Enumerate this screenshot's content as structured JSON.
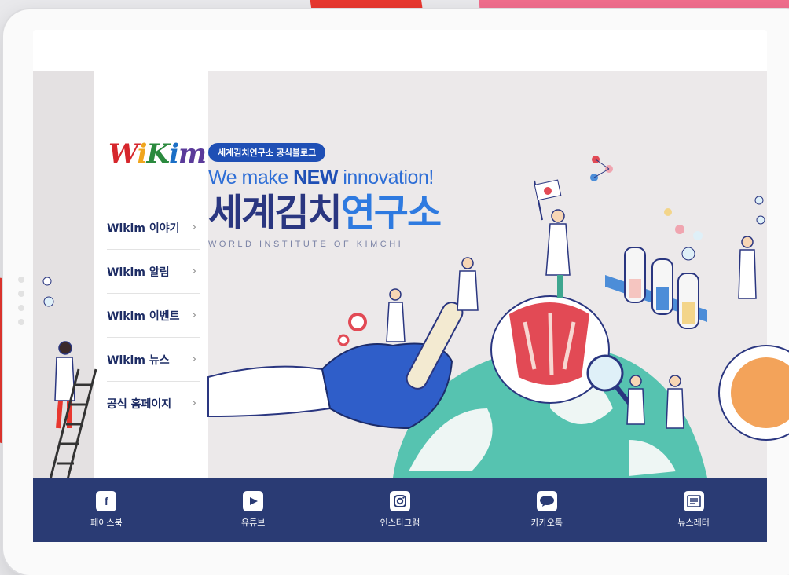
{
  "blog": {
    "logo_text": "WiKim",
    "tag": "세계김치연구소 공식블로그",
    "tagline_prefix": "We make",
    "tagline_emph": "NEW",
    "tagline_suffix": "innovation!",
    "title_part1": "세계김치",
    "title_part2": "연구소",
    "subtitle": "WORLD INSTITUTE OF KIMCHI"
  },
  "sidebar": {
    "items": [
      {
        "label": "Wikim 이야기",
        "arrow": "›"
      },
      {
        "label": "Wikim 알림",
        "arrow": "›"
      },
      {
        "label": "Wikim 이벤트",
        "arrow": "›"
      },
      {
        "label": "Wikim 뉴스",
        "arrow": "›"
      },
      {
        "label": "공식 홈페이지",
        "arrow": "›"
      }
    ]
  },
  "footer": {
    "items": [
      {
        "label": "페이스북",
        "icon": "facebook-icon"
      },
      {
        "label": "유튜브",
        "icon": "youtube-icon"
      },
      {
        "label": "인스타그램",
        "icon": "instagram-icon"
      },
      {
        "label": "카카오톡",
        "icon": "kakaotalk-icon"
      },
      {
        "label": "뉴스레터",
        "icon": "newsletter-icon"
      }
    ]
  },
  "colors": {
    "navy": "#2a3b74",
    "brand_blue": "#2e7ae0",
    "accent_red": "#e8372f",
    "accent_pink": "#f06d8d"
  }
}
